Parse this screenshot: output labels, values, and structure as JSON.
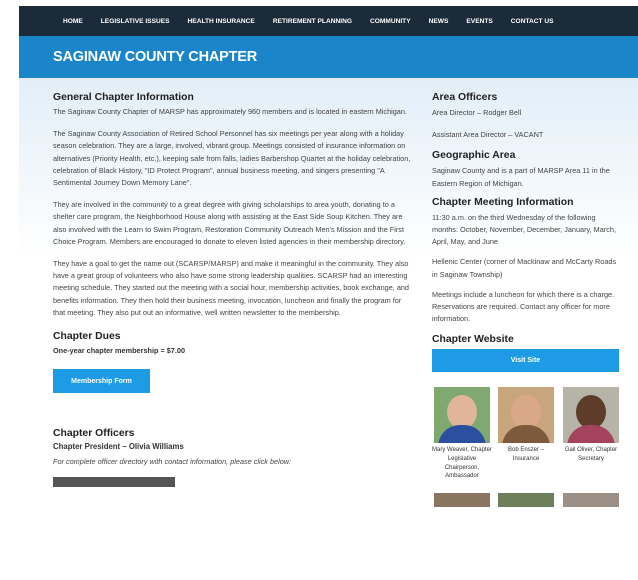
{
  "nav": {
    "items": [
      "HOME",
      "LEGISLATIVE ISSUES",
      "HEALTH INSURANCE",
      "RETIREMENT PLANNING",
      "COMMUNITY",
      "NEWS",
      "EVENTS",
      "CONTACT US"
    ]
  },
  "page_title": "SAGINAW COUNTY CHAPTER",
  "main": {
    "general_heading": "General Chapter Information",
    "general_p1": "The Saginaw County Chapter of MARSP has approximately 960 members and is located in eastern Michigan.",
    "general_p2": "The Saginaw County Association of Retired School Personnel has six meetings per year along with a holiday season celebration. They are a large, involved, vibrant group. Meetings consisted of insurance information on alternatives (Priority Health, etc.), keeping safe from falls, ladies Barbershop Quartet at the holiday celebration, celebration of Black History, \"ID Protect Program\", annual business meeting, and singers presenting \"A Sentimental Journey Down Memory Lane\".",
    "general_p3": "They are involved in the community to a great degree with giving scholarships to area youth, donating to a shelter care program, the Neighborhood House along with assisting at the East Side Soup Kitchen. They are also involved with the Learn to Swim Program, Restoration Community Outreach Men's Mission and the First Choice Program. Members are encouraged to donate to eleven listed agencies in their membership directory.",
    "general_p4": "They have a goal to get the name out (SCARSP/MARSP) and make it meaningful in the community. They also have a great group of volunteers who also have some strong leadership qualities. SCARSP had an interesting meeting schedule. They started out the meeting with a social hour, membership activities, book exchange, and benefits information. They then hold their business meeting, invocation, luncheon and finally the program for that meeting. They also put out an informative, well written newsletter to the membership.",
    "dues_heading": "Chapter Dues",
    "dues_text": "One-year chapter membership = $7.00",
    "membership_button": "Membership Form",
    "officers_heading": "Chapter Officers",
    "president": "Chapter President – Olivia Williams",
    "directory_note": "For complete officer directory with contact information, please click below:"
  },
  "side": {
    "area_officers_heading": "Area Officers",
    "area_director": "Area Director – Rodger Bell",
    "assistant_director": "Assistant Area Director – VACANT",
    "geo_heading": "Geographic Area",
    "geo_text": "Saginaw County and is a part of MARSP Area 11 in the Eastern Region of Michigan.",
    "meeting_heading": "Chapter Meeting Information",
    "meeting_text": "11:30 a.m. on the third Wednesday of the following months: October, November, December, January, March, April, May, and June",
    "location_text": "Hellenic Center (corner of Mackinaw and McCarty Roads in Saginaw Township)",
    "luncheon_text": "Meetings include a luncheon for which there is a charge. Reservations are required. Contact any officer for more information.",
    "website_heading": "Chapter Website",
    "visit_button": "Visit Site",
    "people": [
      {
        "caption": "Mary Weaver, Chapter Legislative Chairperson, Ambassador"
      },
      {
        "caption": "Bob Enszer – Insurance"
      },
      {
        "caption": "Gail Oliver, Chapter Secretary"
      }
    ]
  },
  "colors": {
    "nav_bg": "#1b2b3a",
    "banner_bg": "#1a86c9",
    "button_bg": "#1e9be5"
  }
}
